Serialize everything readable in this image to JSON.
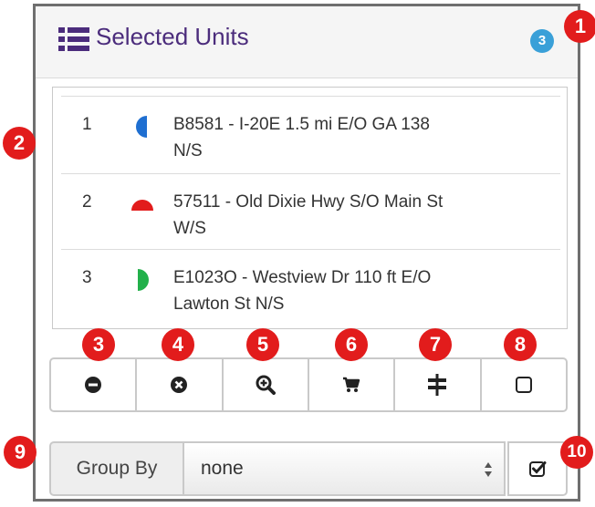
{
  "panel": {
    "title": "Selected Units",
    "count": "3",
    "title_color": "#4b2c7c",
    "badge_color": "#3aa0d8"
  },
  "units": [
    {
      "num": "1",
      "line1": "B8581 - I-20E 1.5 mi E/O GA 138",
      "line2": "N/S",
      "icon": "half-circle-left-blue-icon",
      "color": "#1f6fd1"
    },
    {
      "num": "2",
      "line1": "57511 - Old Dixie Hwy S/O Main St",
      "line2": "W/S",
      "icon": "half-circle-top-red-icon",
      "color": "#e21c1c"
    },
    {
      "num": "3",
      "line1": "E1023O - Westview Dr 110 ft E/O",
      "line2": "Lawton St N/S",
      "icon": "half-circle-right-green-icon",
      "color": "#22b04a"
    }
  ],
  "toolbar": {
    "buttons": [
      {
        "name": "minus-circle-icon"
      },
      {
        "name": "times-circle-icon"
      },
      {
        "name": "zoom-in-icon"
      },
      {
        "name": "cart-icon"
      },
      {
        "name": "road-sign-icon"
      },
      {
        "name": "checkbox-empty-icon"
      }
    ]
  },
  "group": {
    "label": "Group By",
    "selected": "none"
  },
  "callouts": [
    "1",
    "2",
    "3",
    "4",
    "5",
    "6",
    "7",
    "8",
    "9",
    "10"
  ],
  "callout_color": "#e21c1c"
}
